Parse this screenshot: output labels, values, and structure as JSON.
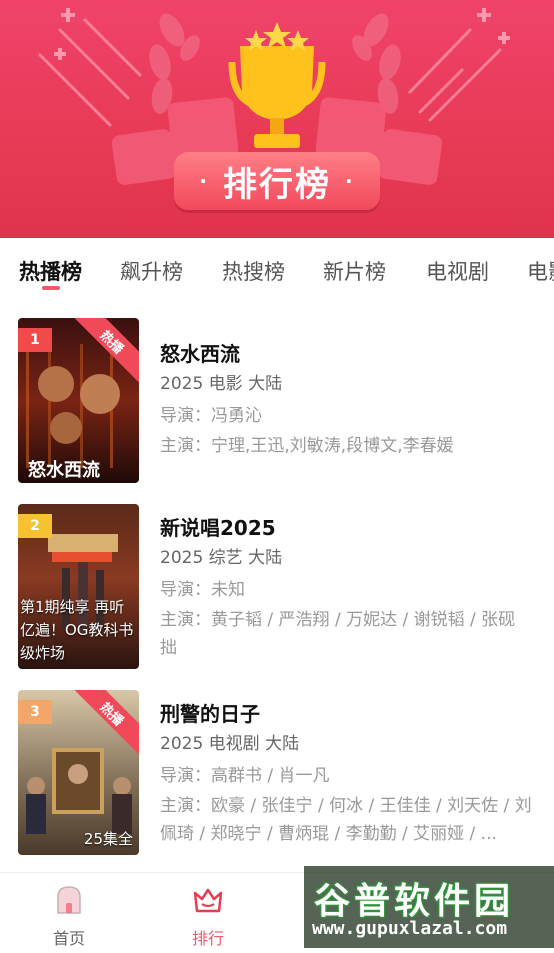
{
  "banner": {
    "title": "排行榜",
    "dot_left": "·",
    "dot_right": "·"
  },
  "tabs": [
    {
      "label": "热播榜",
      "active": true
    },
    {
      "label": "飙升榜",
      "active": false
    },
    {
      "label": "热搜榜",
      "active": false
    },
    {
      "label": "新片榜",
      "active": false
    },
    {
      "label": "电视剧",
      "active": false
    },
    {
      "label": "电影",
      "active": false
    }
  ],
  "items": [
    {
      "rank": "1",
      "badge": "热播",
      "title": "怒水西流",
      "meta": "2025  电影  大陆",
      "director_label": "导演：",
      "director": "冯勇沁",
      "cast_label": "主演：",
      "cast": "宁理,王迅,刘敏涛,段博文,李春媛",
      "poster_caption": "",
      "poster_episodes": ""
    },
    {
      "rank": "2",
      "badge": "",
      "title": "新说唱2025",
      "meta": "2025  综艺  大陆",
      "director_label": "导演：",
      "director": "未知",
      "cast_label": "主演：",
      "cast": "黄子韬 / 严浩翔 / 万妮达 / 谢锐韬 / 张砚拙",
      "poster_caption": "第1期纯享 再听亿遍！OG教科书级炸场",
      "poster_episodes": ""
    },
    {
      "rank": "3",
      "badge": "热播",
      "title": "刑警的日子",
      "meta": "2025  电视剧  大陆",
      "director_label": "导演：",
      "director": "高群书 / 肖一凡",
      "cast_label": "主演：",
      "cast": "欧豪 / 张佳宁 / 何冰 / 王佳佳 / 刘天佐 / 刘佩琦 / 郑晓宁 / 曹炳琨 / 李勤勤 / 艾丽娅 / ...",
      "poster_caption": "",
      "poster_episodes": "25集全"
    }
  ],
  "nav": {
    "home": "首页",
    "ranking": "排行"
  },
  "watermark": {
    "brand": "谷普软件园",
    "url": "www.gupuxlazal.com"
  },
  "colors": {
    "accent": "#f2586a",
    "banner": "#e73a55"
  }
}
